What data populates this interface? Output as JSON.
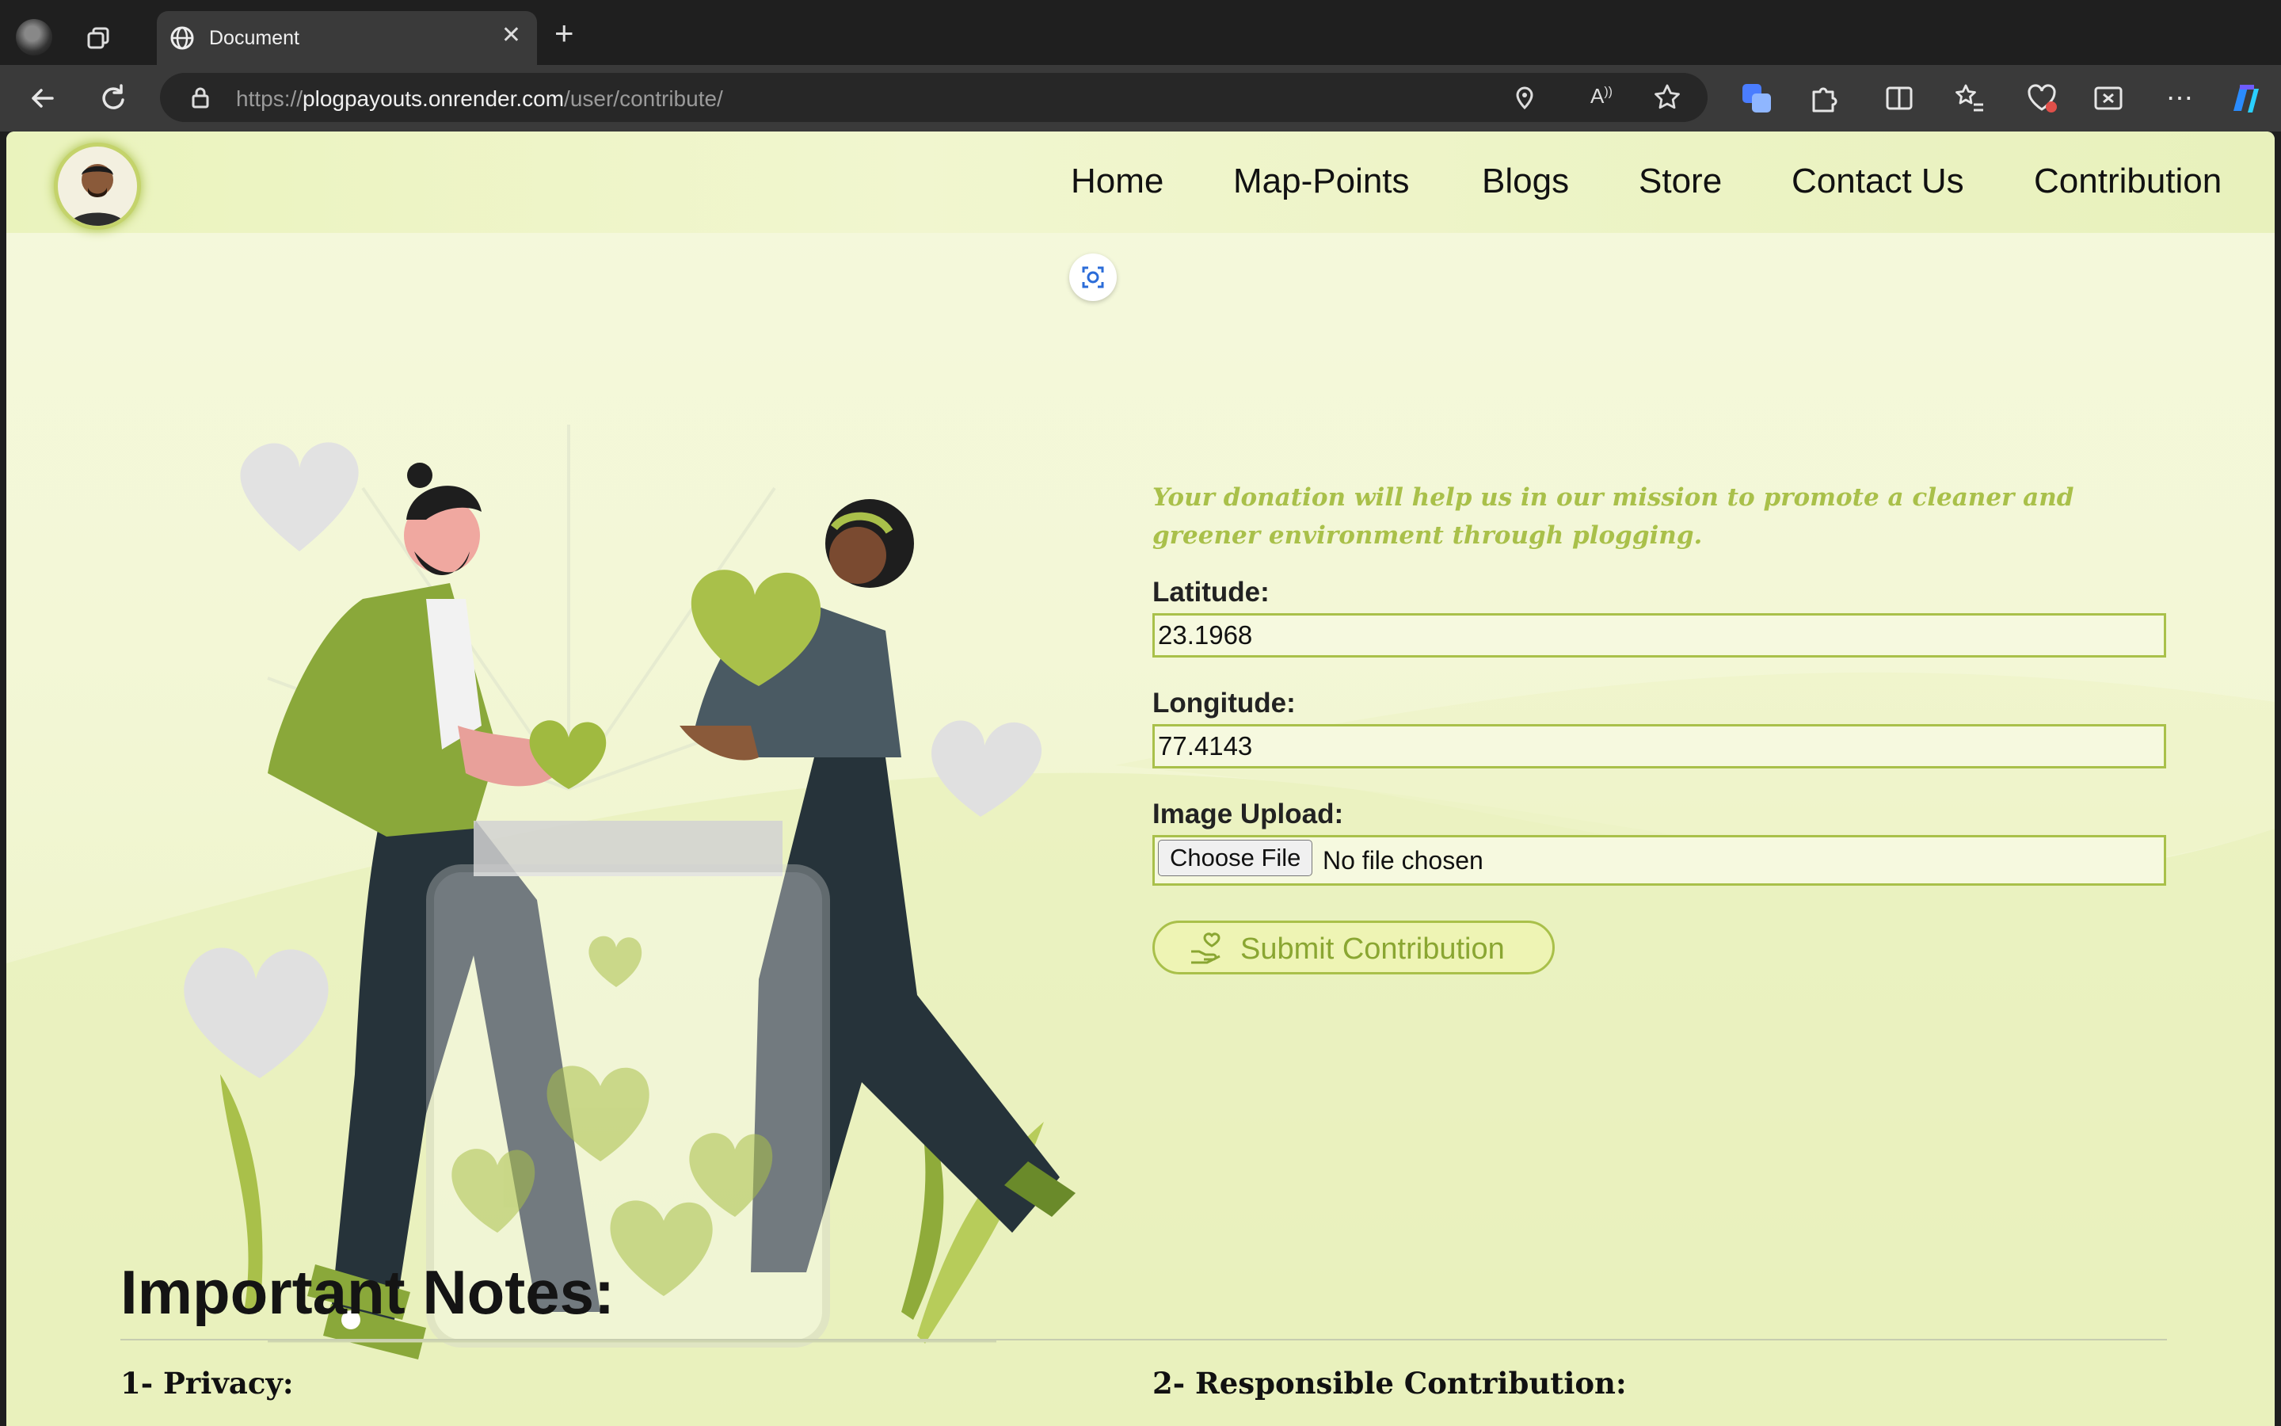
{
  "browser": {
    "tab_title": "Document",
    "url_prefix": "https://",
    "url_host": "plogpayouts.onrender.com",
    "url_path": "/user/contribute/"
  },
  "nav": {
    "links": [
      "Home",
      "Map-Points",
      "Blogs",
      "Store",
      "Contact Us",
      "Contribution"
    ]
  },
  "form": {
    "intro": "Your donation will help us in our mission to promote a cleaner and greener environment through plogging.",
    "latitude_label": "Latitude:",
    "latitude_value": "23.1968",
    "longitude_label": "Longitude:",
    "longitude_value": "77.4143",
    "image_label": "Image Upload:",
    "choose_file": "Choose File",
    "no_file": "No file chosen",
    "submit": "Submit Contribution"
  },
  "notes": {
    "heading": "Important Notes:",
    "items": [
      "1- Privacy:",
      "2- Responsible Contribution:"
    ]
  },
  "colors": {
    "accent": "#a9c04a",
    "page_bg": "#f3f7d6",
    "chrome_bg": "#3a3a3a"
  }
}
